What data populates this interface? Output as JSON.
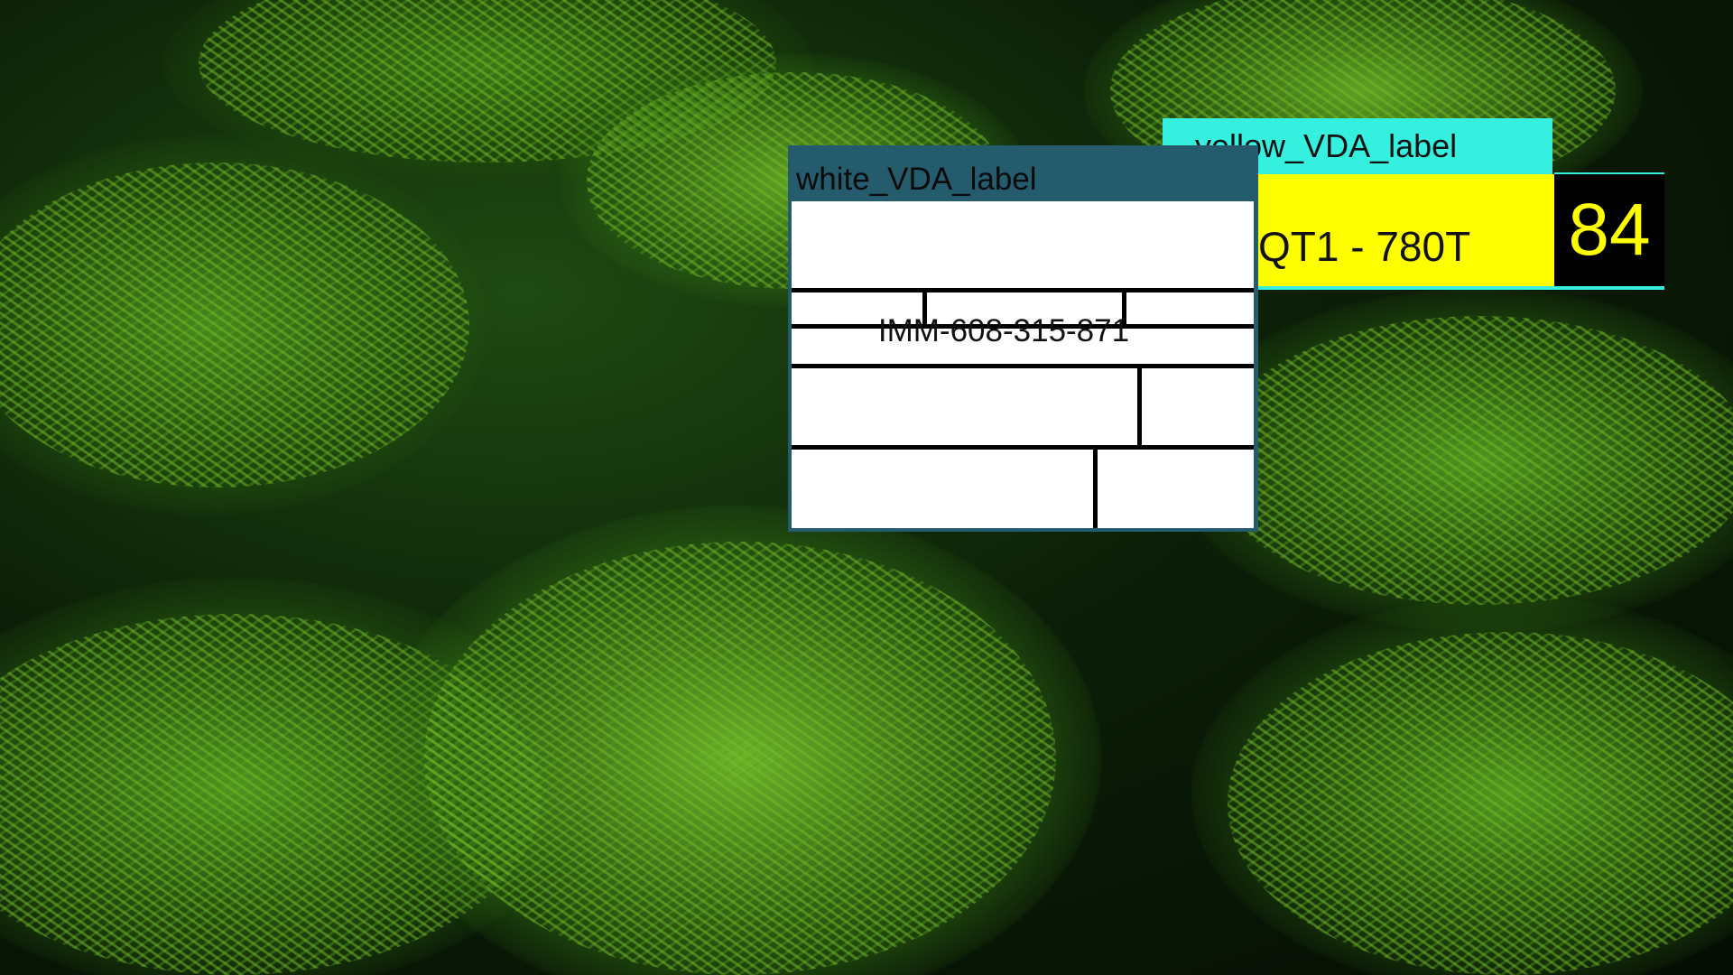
{
  "colors": {
    "yellow_titlebar": "#35f0de",
    "yellow_field": "#ffff00",
    "count_box": "#000000",
    "count_text": "#ffff00",
    "white_window_frame": "#245c6e"
  },
  "desktop": {
    "wallpaper": "fir-branches-photo"
  },
  "yellow_label_window": {
    "title": "yellow_VDA_label",
    "code": "QT1 - 780T",
    "count": "84"
  },
  "white_label_window": {
    "title": "white_VDA_label",
    "id": "IMM-608-315-871"
  }
}
